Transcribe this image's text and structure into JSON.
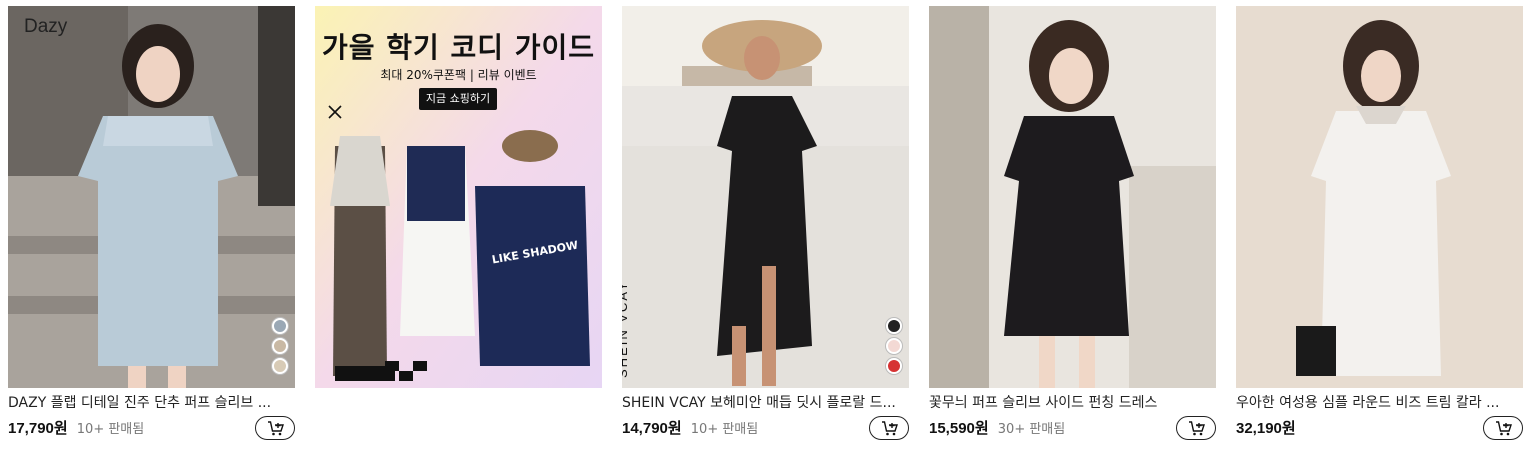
{
  "colors": {
    "accent": "#111111",
    "sold_text": "#777777"
  },
  "products": [
    {
      "image_label": "Dazy",
      "title": "DAZY 플랩 디테일 진주 단추 퍼프 슬리브 ...",
      "price": "17,790원",
      "sold": "10+ 판매됨",
      "swatches": [
        "#9aa8b5",
        "#c9b9a4",
        "#d8cbb6"
      ]
    },
    {
      "ad_title": "가을 학기 코디 가이드",
      "ad_subtitle": "최대 20%쿠폰팩 | 리뷰 이벤트",
      "ad_button": "지금 쇼핑하기",
      "shirt_text": "LIKE SHADOW"
    },
    {
      "image_label": "SHEIN VCAY",
      "title": "SHEIN VCAY 보헤미안 매듭 딧시 플로랄 드...",
      "price": "14,790원",
      "sold": "10+ 판매됨",
      "swatches": [
        "#222222",
        "#f3d9d4",
        "#d63333"
      ]
    },
    {
      "title": "꽃무늬 퍼프 슬리브 사이드 펀칭 드레스",
      "price": "15,590원",
      "sold": "30+ 판매됨"
    },
    {
      "title": "우아한 여성용 심플 라운드 비즈 트림 칼라 ...",
      "price": "32,190원"
    }
  ],
  "icons": {
    "cart": "cart-add-icon",
    "ad_close": "close-icon"
  }
}
